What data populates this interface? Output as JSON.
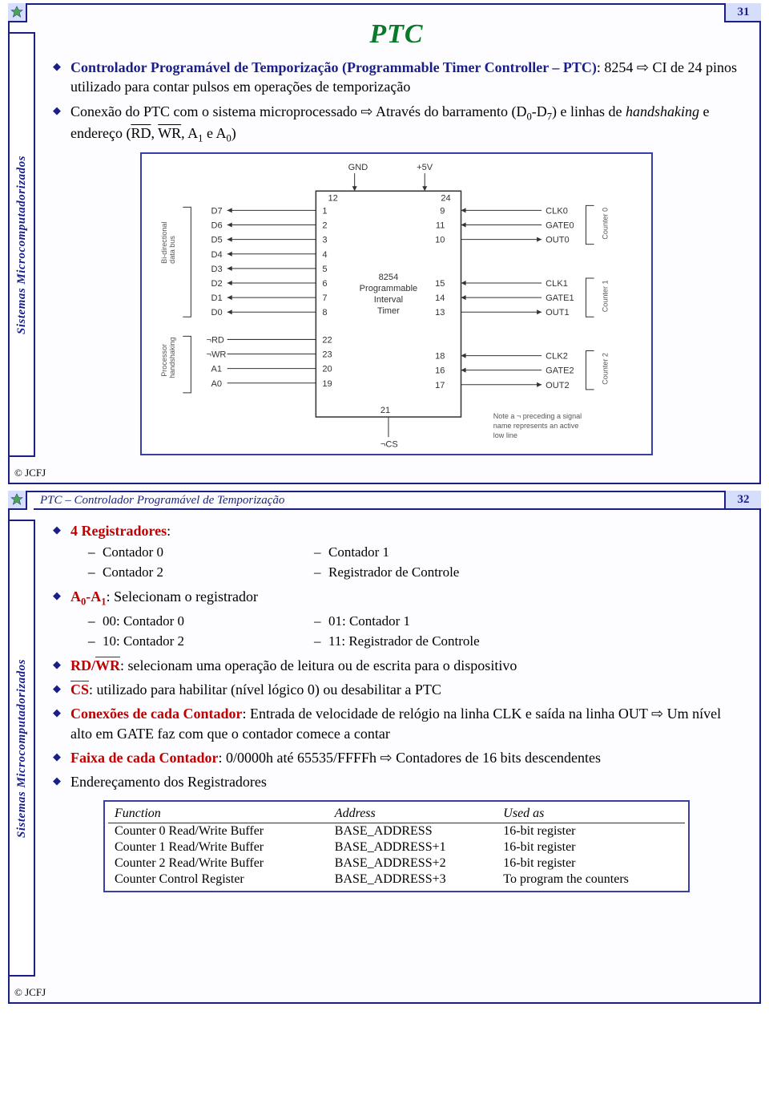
{
  "common": {
    "sidebar_label": "Sistemas Microcomputadorizados",
    "footer": "© JCFJ"
  },
  "slide1": {
    "page": "31",
    "title": "PTC",
    "bullets": {
      "b1_pre": "Controlador Programável de Temporização (Programmable Timer Controller – PTC)",
      "b1_post": ": 8254 ⇨ CI de 24 pinos utilizado para contar pulsos em operações de temporização",
      "b2_a": "Conexão do PTC com o sistema microprocessado ⇨ Através do barramento (D",
      "b2_sub0": "0",
      "b2_b": "-D",
      "b2_sub7": "7",
      "b2_c": ") e linhas de ",
      "b2_hand": "handshaking",
      "b2_d": " e endereço (",
      "b2_rd": "RD",
      "b2_e": ", ",
      "b2_wr": "WR",
      "b2_f": ", A",
      "b2_s1": "1",
      "b2_g": " e A",
      "b2_s0": "0",
      "b2_h": ")"
    },
    "diagram": {
      "top_left": "GND",
      "top_right": "+5V",
      "pin_tl": "12",
      "pin_tr": "24",
      "left_label_top": "Bi-directional",
      "left_label_bot": "data bus",
      "left_label2_top": "Processor",
      "left_label2_bot": "handshaking",
      "d7": "D7",
      "d6": "D6",
      "d5": "D5",
      "d4": "D4",
      "d3": "D3",
      "d2": "D2",
      "d1": "D1",
      "d0": "D0",
      "p1": "1",
      "p2": "2",
      "p3": "3",
      "p4": "4",
      "p5": "5",
      "p6": "6",
      "p7": "7",
      "p8": "8",
      "rd": "¬RD",
      "wr": "¬WR",
      "a1": "A1",
      "a0": "A0",
      "p22": "22",
      "p23": "23",
      "p20": "20",
      "p19": "19",
      "p21": "21",
      "cs": "¬CS",
      "chip_l1": "8254",
      "chip_l2": "Programmable",
      "chip_l3": "Interval",
      "chip_l4": "Timer",
      "p9": "9",
      "p11": "11",
      "p10": "10",
      "p15": "15",
      "p14": "14",
      "p13": "13",
      "p18": "18",
      "p16": "16",
      "p17": "17",
      "clk0": "CLK0",
      "gate0": "GATE0",
      "out0": "OUT0",
      "clk1": "CLK1",
      "gate1": "GATE1",
      "out1": "OUT1",
      "clk2": "CLK2",
      "gate2": "GATE2",
      "out2": "OUT2",
      "c0": "Counter 0",
      "c1": "Counter 1",
      "c2": "Counter 2",
      "note1": "Note a ¬ preceding a signal",
      "note2": "name represents an active",
      "note3": "low line"
    }
  },
  "slide2": {
    "page": "32",
    "subtitle": "PTC – Controlador Programável de Temporização",
    "b1_head": "4 Registradores",
    "b1_colon": ":",
    "s1a": "Contador 0",
    "s1b": "Contador 1",
    "s2a": "Contador 2",
    "s2b": "Registrador de Controle",
    "b2_head": "A",
    "b2_h0": "0",
    "b2_mid": "-A",
    "b2_h1": "1",
    "b2_tail": ": Selecionam o registrador",
    "s3a": "00: Contador 0",
    "s3b": "01: Contador 1",
    "s4a": "10: Contador 2",
    "s4b": "11: Registrador de Controle",
    "b3_rd": "RD/",
    "b3_wr": "WR",
    "b3_tail": ": selecionam uma operação de leitura ou de escrita para o dispositivo",
    "b4_cs": "CS",
    "b4_tail": ": utilizado para habilitar (nível lógico 0) ou desabilitar a PTC",
    "b5_head": "Conexões de cada Contador",
    "b5_tail": ": Entrada de velocidade de relógio na linha CLK e saída na linha OUT ⇨ Um nível alto em GATE faz com que o contador comece a contar",
    "b6_head": "Faixa de cada Contador",
    "b6_tail": ": 0/0000h até 65535/FFFFh ⇨ Contadores de 16 bits descendentes",
    "b7": "Endereçamento dos Registradores",
    "table": {
      "h1": "Function",
      "h2": "Address",
      "h3": "Used as",
      "rows": [
        {
          "f": "Counter 0 Read/Write Buffer",
          "a": "BASE_ADDRESS",
          "u": "16-bit register"
        },
        {
          "f": "Counter 1 Read/Write Buffer",
          "a": "BASE_ADDRESS+1",
          "u": "16-bit register"
        },
        {
          "f": "Counter 2 Read/Write Buffer",
          "a": "BASE_ADDRESS+2",
          "u": "16-bit register"
        },
        {
          "f": "Counter Control Register",
          "a": "BASE_ADDRESS+3",
          "u": "To program the counters"
        }
      ]
    }
  }
}
